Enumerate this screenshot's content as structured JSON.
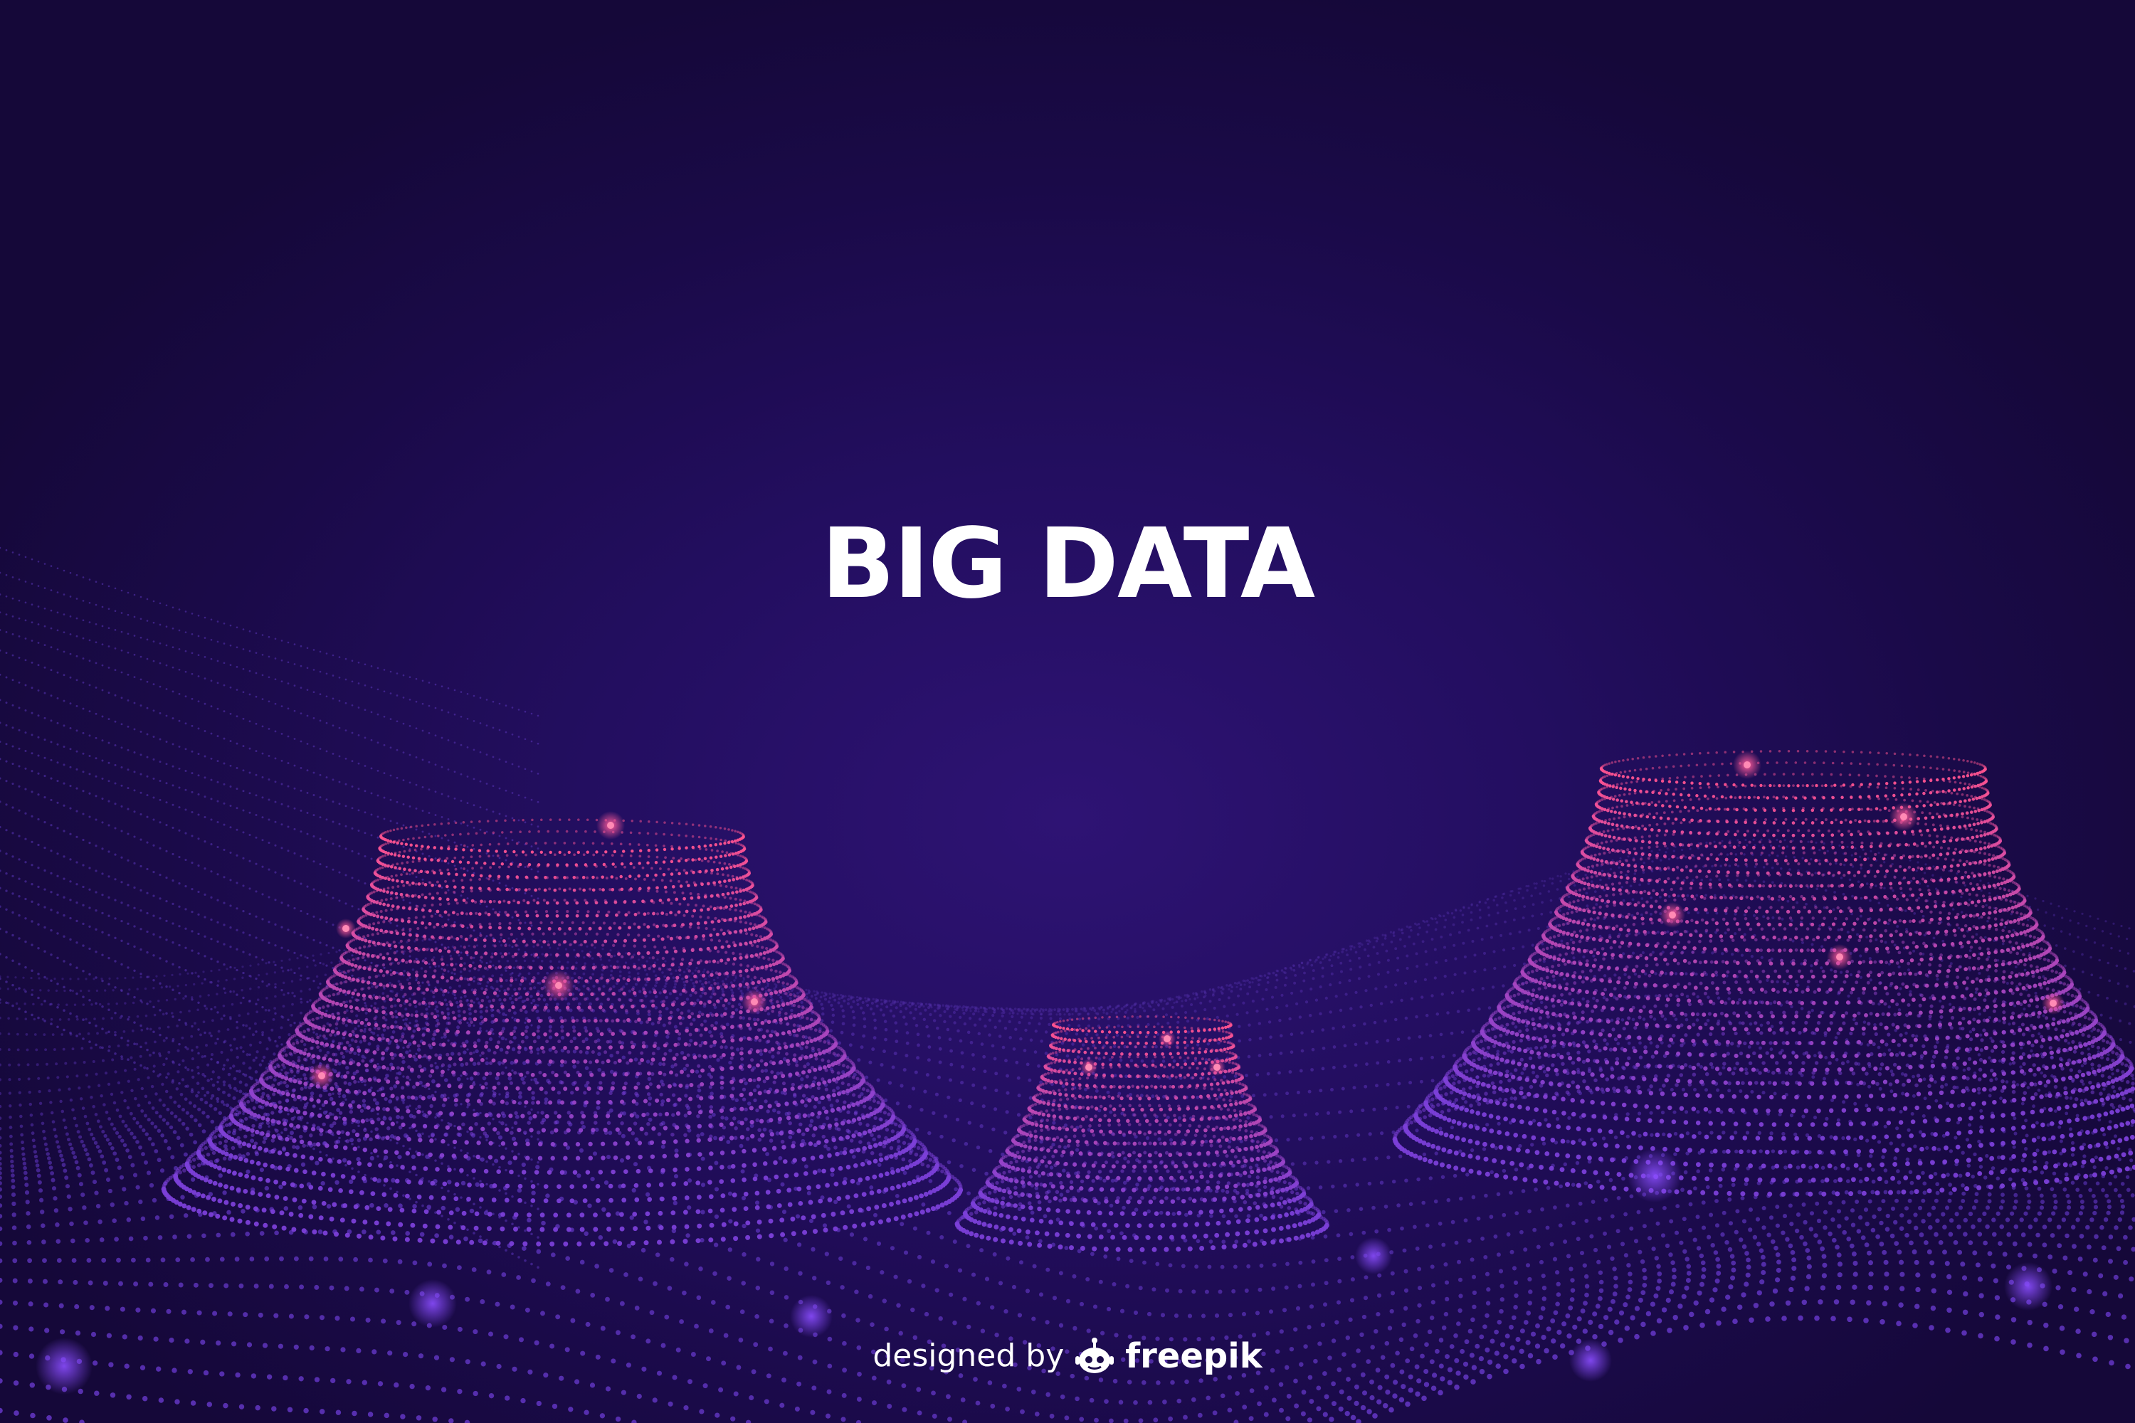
{
  "headline": "BIG DATA",
  "credit": {
    "prefix": "designed by",
    "brand": "freepik"
  },
  "icons": {
    "logo": "freepik-robot-icon"
  },
  "colors": {
    "background_top": "#150839",
    "background_center": "#2e1374",
    "dot_top": "#ff4f8a",
    "dot_bottom": "#7a3bd6",
    "text": "#ffffff"
  }
}
